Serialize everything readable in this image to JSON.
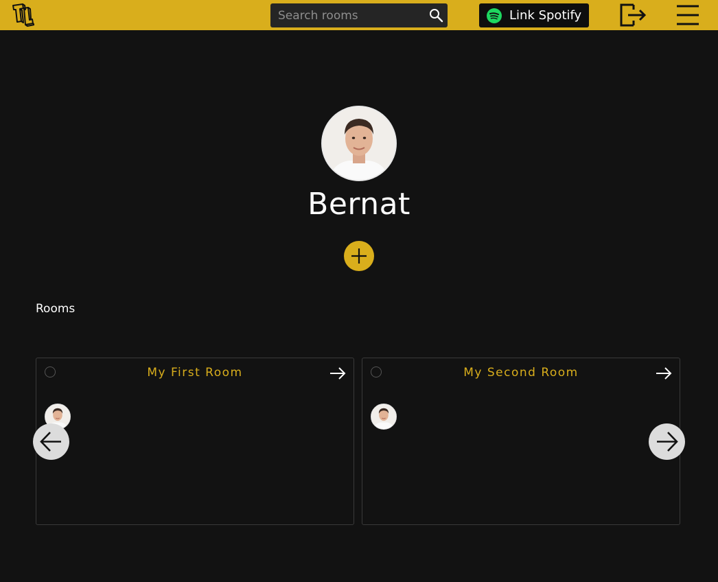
{
  "header": {
    "logo_icon": "tl-logo-icon",
    "search": {
      "placeholder": "Search rooms",
      "value": "",
      "icon": "search-icon"
    },
    "spotify_button": {
      "label": "Link Spotify",
      "icon": "spotify-icon"
    },
    "logout_icon": "logout-icon",
    "menu_icon": "hamburger-menu-icon",
    "accent_color": "#d9ae1c"
  },
  "profile": {
    "name": "Bernat",
    "avatar": "user-avatar",
    "add_button_icon": "plus-icon"
  },
  "rooms_section": {
    "label": "Rooms",
    "rooms": [
      {
        "title": "My First Room",
        "members": [
          "member-avatar"
        ]
      },
      {
        "title": "My Second Room",
        "members": [
          "member-avatar"
        ]
      }
    ],
    "prev_icon": "arrow-left-icon",
    "next_icon": "arrow-right-icon"
  },
  "colors": {
    "background": "#121212",
    "topbar": "#d9ae1c",
    "room_title": "#d9ae1c"
  }
}
